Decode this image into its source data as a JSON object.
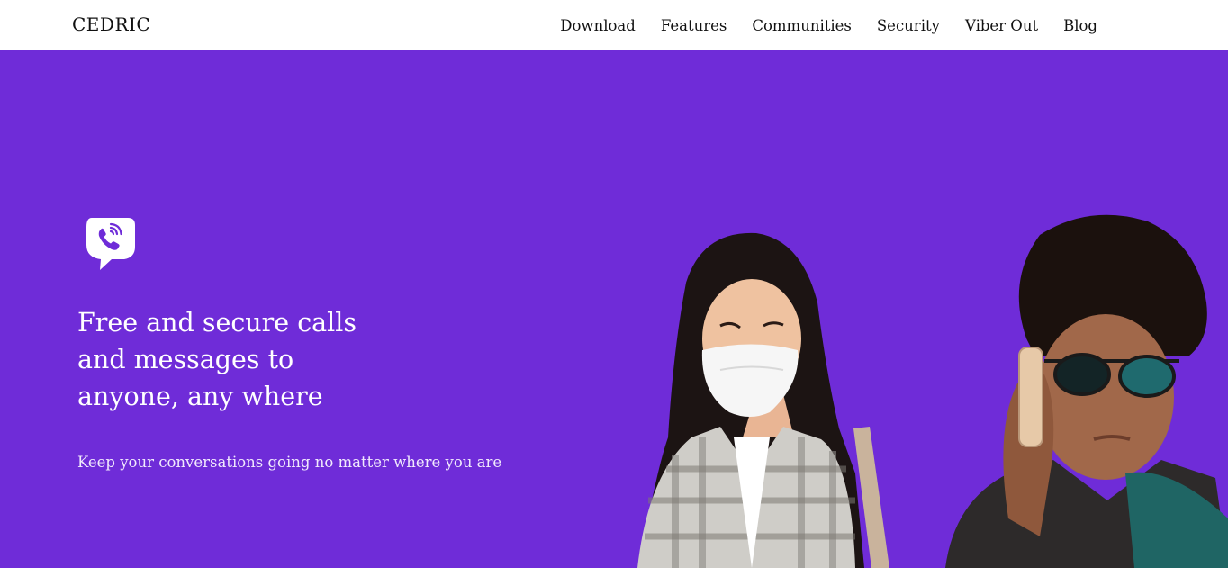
{
  "header": {
    "brand": "CEDRIC",
    "nav": [
      {
        "label": "Download"
      },
      {
        "label": "Features"
      },
      {
        "label": "Communities"
      },
      {
        "label": "Security"
      },
      {
        "label": "Viber Out"
      },
      {
        "label": "Blog"
      }
    ]
  },
  "hero": {
    "logo_icon": "viber-phone-bubble-icon",
    "headline": "Free and secure calls and messages to anyone, any where",
    "subline": "Keep your conversations going no matter where you are",
    "photo": "two-people-on-phone-photo"
  },
  "colors": {
    "hero_bg": "#6f2cd8",
    "header_bg": "#ffffff",
    "text_dark": "#111111",
    "text_light": "#ffffff"
  }
}
